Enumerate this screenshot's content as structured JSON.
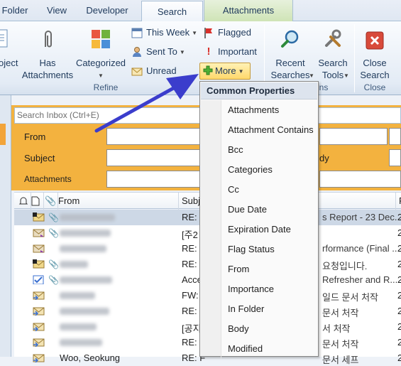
{
  "tabs": [
    "Folder",
    "View",
    "Developer",
    "Search",
    "Attachments"
  ],
  "ribbon": {
    "left_buttons": [
      "oject",
      "Has\nAttachments",
      "Categorized"
    ],
    "small": [
      "This Week",
      "Sent To",
      "Unread",
      "Flagged",
      "Important",
      "More"
    ],
    "group_refine": "Refine",
    "recent_searches": "Recent\nSearches",
    "search_tools": "Search\nTools",
    "close_search": "Close\nSearch",
    "group_options": "ns",
    "group_close": "Close"
  },
  "search": {
    "placeholder": "Search Inbox (Ctrl+E)",
    "fields": [
      "From",
      "Subject",
      "Attachments"
    ],
    "right_label": "dy"
  },
  "list_header": {
    "from": "From",
    "subject": "Subj",
    "right": "R"
  },
  "rows": [
    {
      "subject": "RE: K",
      "tail": "s Report - 23 Dec...",
      "right": "2",
      "selected": true,
      "icon": "flag-envelope-icon",
      "clip": true
    },
    {
      "subject": "[주2",
      "tail": "",
      "right": "2",
      "icon": "read-envelope-icon",
      "clip": true
    },
    {
      "subject": "RE: F",
      "tail": "rformance (Final ...",
      "right": "2",
      "icon": "read-envelope-icon",
      "clip": false
    },
    {
      "subject": "RE: F",
      "tail": "요청입니다.",
      "right": "2",
      "icon": "flag-envelope-icon",
      "clip": true
    },
    {
      "subject": "Acce",
      "tail": "Refresher and R...",
      "right": "2",
      "icon": "check-envelope-icon",
      "clip": true
    },
    {
      "subject": "FW:",
      "tail": "일드 문서 처작",
      "right": "2",
      "icon": "forward-envelope-icon",
      "clip": false
    },
    {
      "subject": "RE: C",
      "tail": "문서 처작",
      "right": "2",
      "icon": "forward-envelope-icon",
      "clip": false
    },
    {
      "subject": "[공지",
      "tail": "서 처작",
      "right": "2",
      "icon": "forward-envelope-icon",
      "clip": false
    },
    {
      "subject": "RE: C",
      "tail": "문서 처작",
      "right": "2",
      "icon": "forward-envelope-icon",
      "clip": false
    },
    {
      "sender": "Woo, Seokung",
      "subject": "RE: F",
      "tail": "문서 세프",
      "right": "2",
      "icon": "forward-envelope-icon",
      "clip": false
    }
  ],
  "menu": {
    "header": "Common Properties",
    "items": [
      "Attachments",
      "Attachment Contains",
      "Bcc",
      "Categories",
      "Cc",
      "Due Date",
      "Expiration Date",
      "Flag Status",
      "From",
      "Importance",
      "In Folder",
      "Body",
      "Modified"
    ]
  },
  "colors": {
    "search_band": "#f3b23f",
    "arrow": "#3b3dcc",
    "accent": "#1e395b"
  }
}
